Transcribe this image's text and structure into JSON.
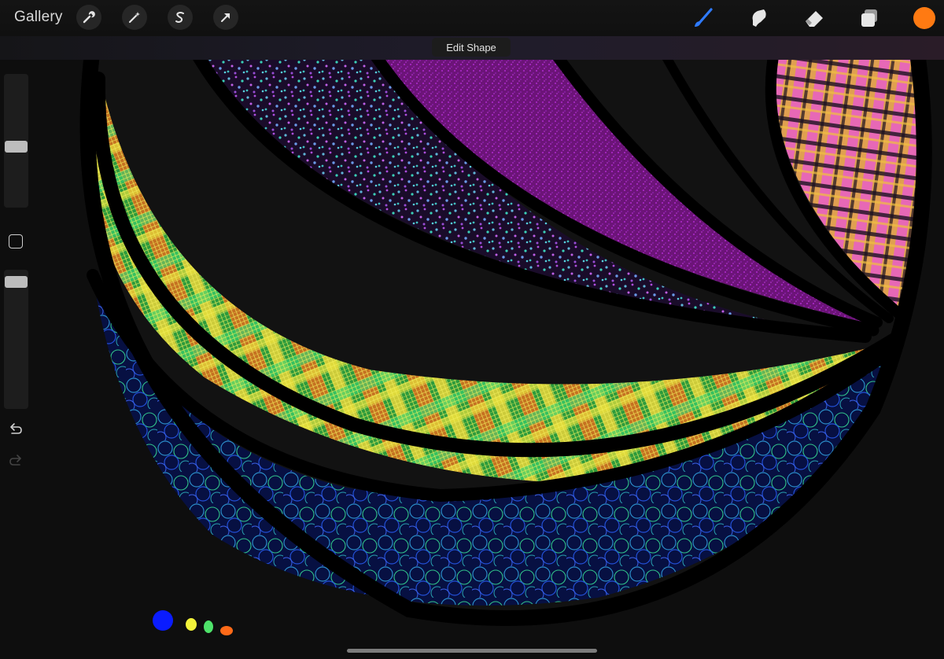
{
  "app": {
    "gallery_label": "Gallery",
    "edit_shape_label": "Edit Shape"
  },
  "toolbar_left": [
    {
      "icon": "wrench-icon",
      "name": "actions"
    },
    {
      "icon": "magic-wand-icon",
      "name": "adjustments"
    },
    {
      "icon": "selection-s-icon",
      "name": "selection"
    },
    {
      "icon": "arrow-cursor-icon",
      "name": "transform"
    }
  ],
  "toolbar_right": [
    {
      "icon": "brush-icon",
      "name": "brush",
      "active": true
    },
    {
      "icon": "smudge-icon",
      "name": "smudge"
    },
    {
      "icon": "eraser-icon",
      "name": "eraser"
    },
    {
      "icon": "layers-icon",
      "name": "layers"
    }
  ],
  "colors": {
    "active_color": "#ff7a12",
    "brush_active_accent": "#2f7bff",
    "canvas_background": "#0e0e0e",
    "outline": "#000000",
    "swatches": [
      "#0a1cff",
      "#f2f23a",
      "#4ee26a",
      "#ff6a18"
    ]
  },
  "sidebar": {
    "brush_size_level": 0.45,
    "opacity_level": 0.95
  }
}
